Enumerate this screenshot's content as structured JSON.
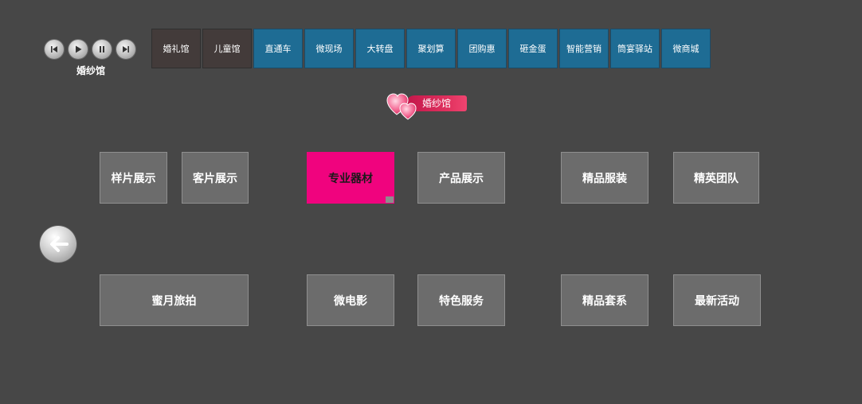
{
  "player": {
    "caption": "婚纱馆",
    "controls": [
      "previous",
      "play",
      "pause",
      "next"
    ]
  },
  "topnav": {
    "tabs": [
      {
        "label": "婚礼馆"
      },
      {
        "label": "儿童馆"
      },
      {
        "label": "直通车"
      },
      {
        "label": "微现场"
      },
      {
        "label": "大转盘"
      },
      {
        "label": "聚划算"
      },
      {
        "label": "团购惠"
      },
      {
        "label": "砸金蛋"
      },
      {
        "label": "智能营销"
      },
      {
        "label": "筒宴驿站"
      },
      {
        "label": "微商城"
      }
    ]
  },
  "page_title": "婚纱馆",
  "tiles": [
    {
      "label": "样片展示"
    },
    {
      "label": "客片展示"
    },
    {
      "label": "专业器材"
    },
    {
      "label": "产品展示"
    },
    {
      "label": "精品服装"
    },
    {
      "label": "精英团队"
    },
    {
      "label": "蜜月旅拍"
    },
    {
      "label": "微电影"
    },
    {
      "label": "特色服务"
    },
    {
      "label": "精品套系"
    },
    {
      "label": "最新活动"
    }
  ],
  "colors": {
    "background": "#474747",
    "tab_dark": "#433b3a",
    "tab_blue": "#1e6c94",
    "tile": "#6c6c6c",
    "tile_active": "#f0037e",
    "ribbon": "#e1325f"
  }
}
